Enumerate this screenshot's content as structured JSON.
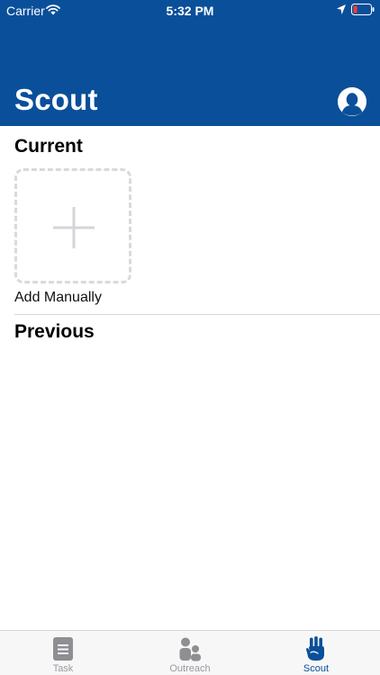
{
  "status_bar": {
    "carrier": "Carrier",
    "time": "5:32 PM",
    "icons": [
      "wifi-icon",
      "location-arrow-icon",
      "battery-low-icon"
    ]
  },
  "header": {
    "title": "Scout",
    "profile_icon": "person-silhouette-icon",
    "background_color": "#0a4f9a"
  },
  "current": {
    "heading": "Current",
    "add_tile_icon": "plus-icon",
    "add_label": "Add Manually"
  },
  "previous": {
    "heading": "Previous"
  },
  "tab_bar": {
    "tabs": [
      {
        "label": "Task",
        "icon": "document-icon",
        "selected": false
      },
      {
        "label": "Outreach",
        "icon": "people-icon",
        "selected": false
      },
      {
        "label": "Scout",
        "icon": "scout-hand-icon",
        "selected": true
      }
    ],
    "active_color": "#0a4f9a",
    "inactive_color": "#9a9a9e"
  }
}
